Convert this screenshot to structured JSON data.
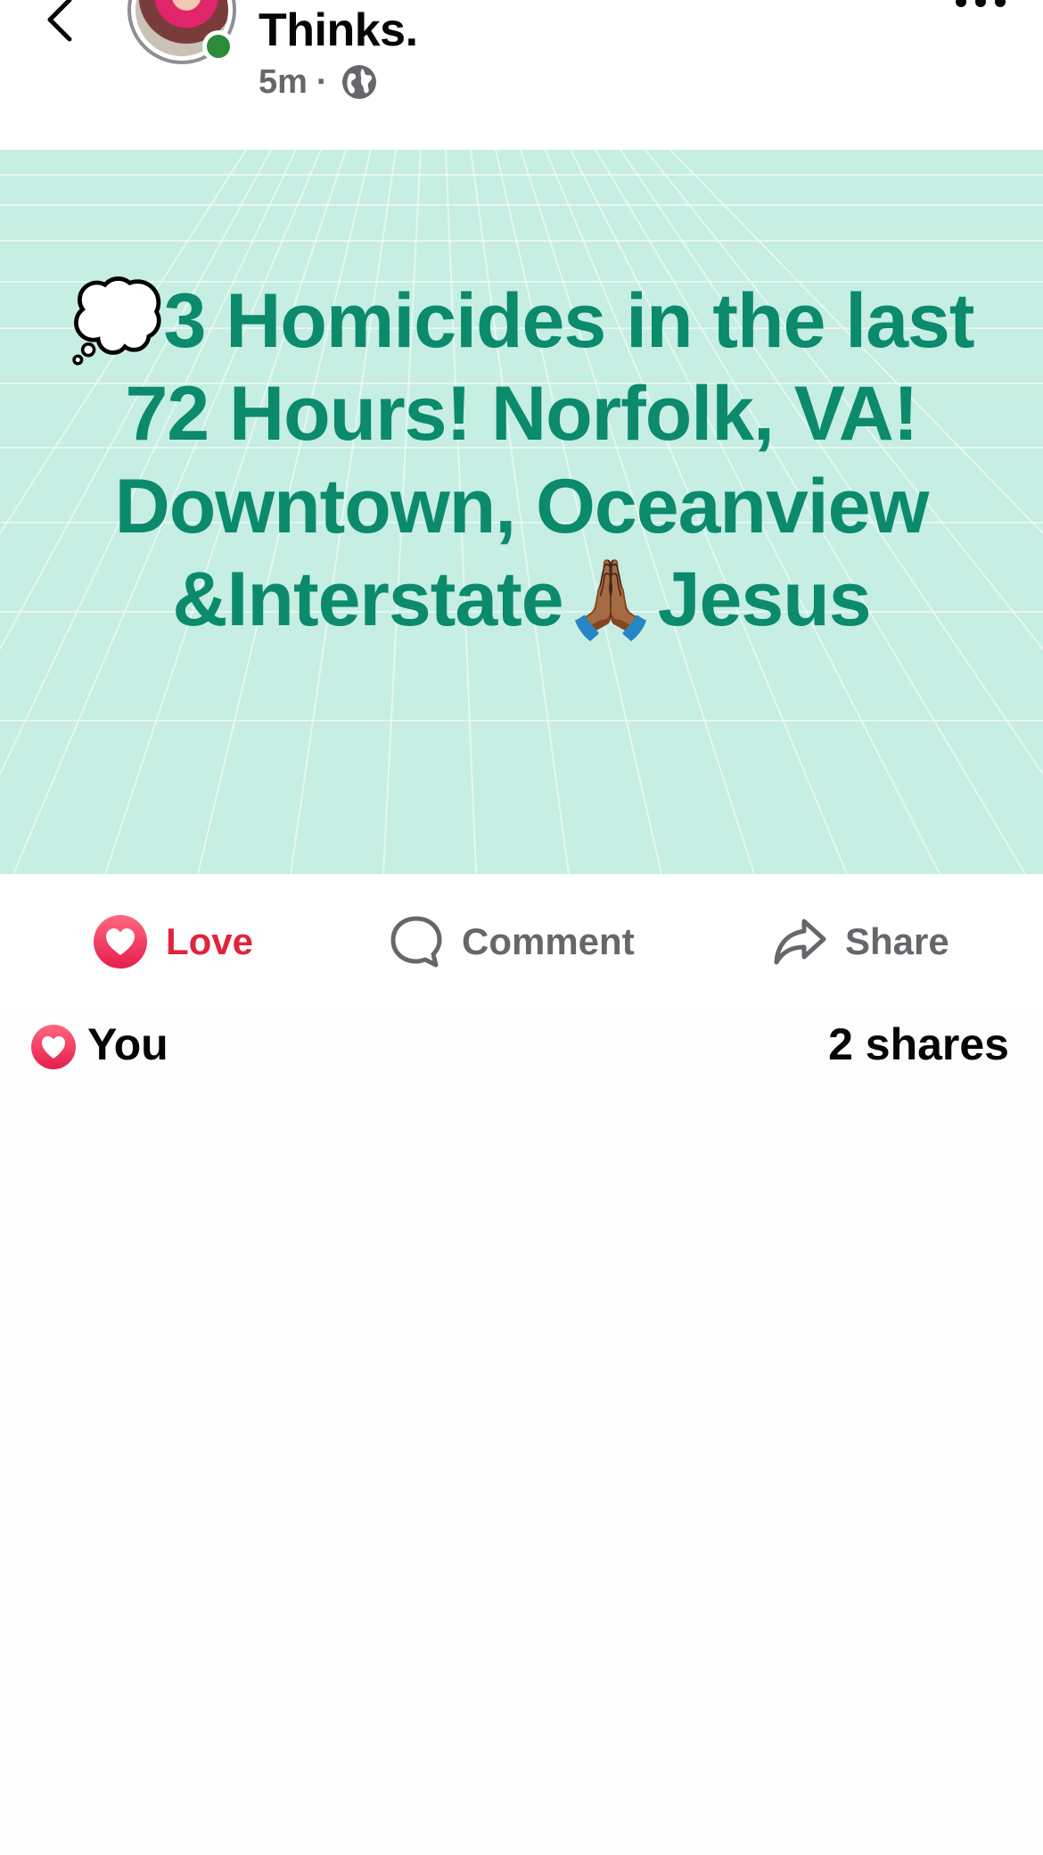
{
  "header": {
    "page_name": "Thinks.",
    "post_time": "5m",
    "separator": "·",
    "privacy_icon": "globe-icon",
    "back_icon": "chevron-left-icon",
    "more_icon": "more-horizontal-icon"
  },
  "post": {
    "text": "💭3 Homicides in the last 72 Hours! Norfolk, VA! Downtown, Oceanview &Interstate🙏🏾Jesus",
    "background_color": "#c6eee2",
    "text_color": "#0b8a6c"
  },
  "actions": {
    "love_label": "Love",
    "comment_label": "Comment",
    "share_label": "Share",
    "love_color": "#e0243c"
  },
  "reactions": {
    "reactor": "You",
    "share_count": "2 shares",
    "reaction_icon": "heart-icon"
  }
}
